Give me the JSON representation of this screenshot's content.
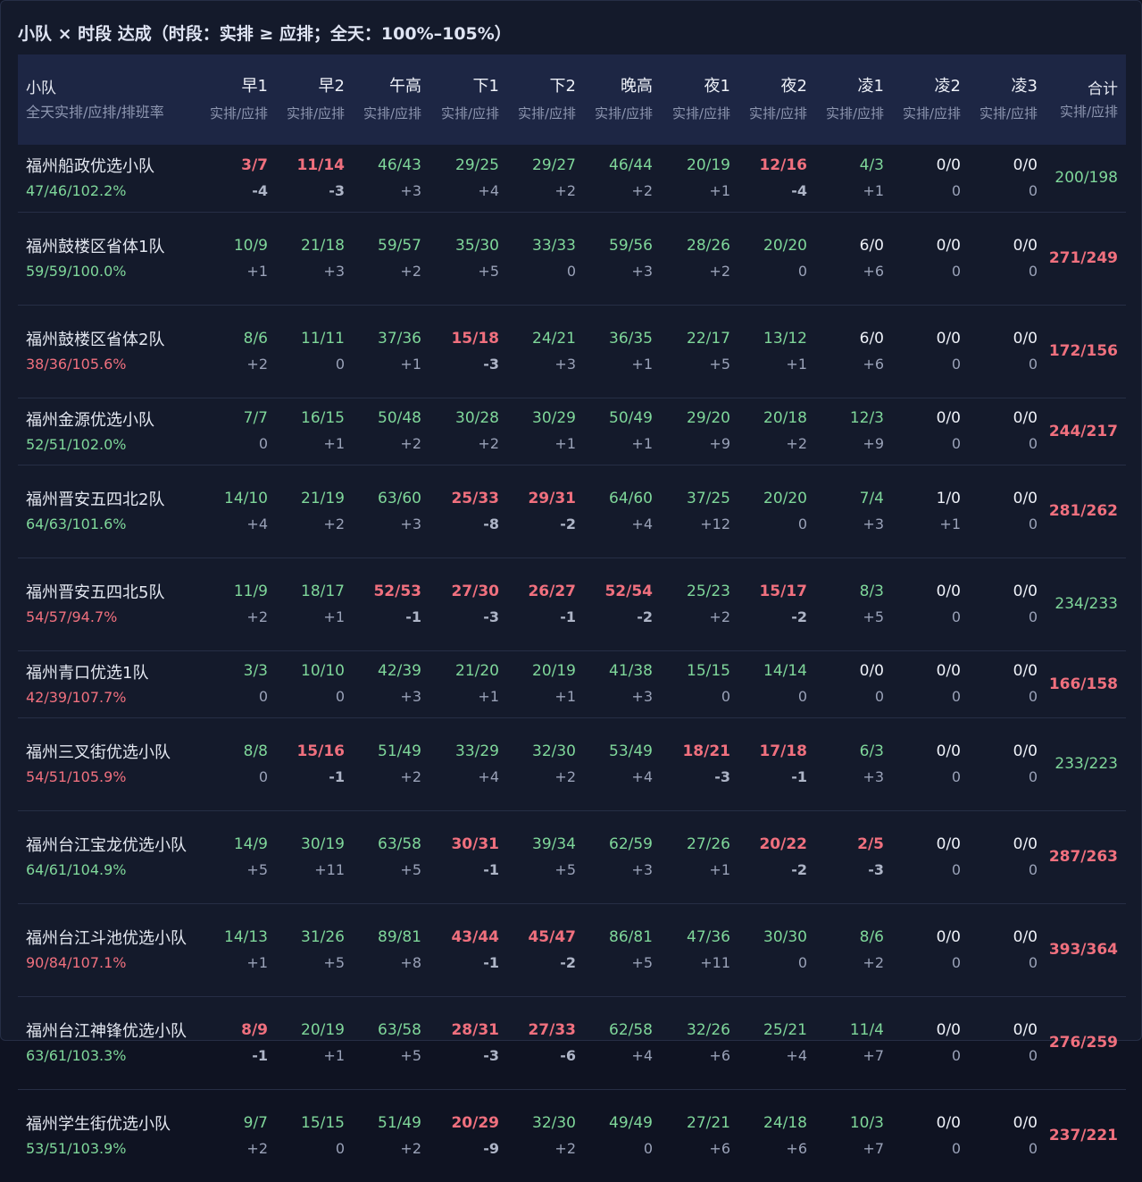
{
  "title": "小队 × 时段 达成（时段：实排 ≥ 应排；全天：100%–105%）",
  "colors": {
    "ok": "#7fd79a",
    "bad": "#f0707e",
    "neutral": "#eef1f8"
  },
  "header": {
    "team_label": "小队",
    "team_sublabel": "全天实排/应排/排班率",
    "slot_sublabel": "实排/应排",
    "total_label": "合计",
    "total_sublabel": "实排/应排",
    "slots": [
      "早1",
      "早2",
      "午高",
      "下1",
      "下2",
      "晚高",
      "夜1",
      "夜2",
      "凌1",
      "凌2",
      "凌3"
    ]
  },
  "rows": [
    {
      "name": "福州船政优选小队",
      "summary": "47/46/102.2%",
      "summary_status": "g",
      "cells": [
        {
          "v": "3/7",
          "d": "-4",
          "s": "r"
        },
        {
          "v": "11/14",
          "d": "-3",
          "s": "r"
        },
        {
          "v": "46/43",
          "d": "+3",
          "s": "g"
        },
        {
          "v": "29/25",
          "d": "+4",
          "s": "g"
        },
        {
          "v": "29/27",
          "d": "+2",
          "s": "g"
        },
        {
          "v": "46/44",
          "d": "+2",
          "s": "g"
        },
        {
          "v": "20/19",
          "d": "+1",
          "s": "g"
        },
        {
          "v": "12/16",
          "d": "-4",
          "s": "r"
        },
        {
          "v": "4/3",
          "d": "+1",
          "s": "g"
        },
        {
          "v": "0/0",
          "d": "0",
          "s": "w"
        },
        {
          "v": "0/0",
          "d": "0",
          "s": "w"
        }
      ],
      "total": "200/198",
      "total_status": "g"
    },
    {
      "name": "福州鼓楼区省体1队",
      "summary": "59/59/100.0%",
      "summary_status": "g",
      "cells": [
        {
          "v": "10/9",
          "d": "+1",
          "s": "g"
        },
        {
          "v": "21/18",
          "d": "+3",
          "s": "g"
        },
        {
          "v": "59/57",
          "d": "+2",
          "s": "g"
        },
        {
          "v": "35/30",
          "d": "+5",
          "s": "g"
        },
        {
          "v": "33/33",
          "d": "0",
          "s": "g"
        },
        {
          "v": "59/56",
          "d": "+3",
          "s": "g"
        },
        {
          "v": "28/26",
          "d": "+2",
          "s": "g"
        },
        {
          "v": "20/20",
          "d": "0",
          "s": "g"
        },
        {
          "v": "6/0",
          "d": "+6",
          "s": "w"
        },
        {
          "v": "0/0",
          "d": "0",
          "s": "w"
        },
        {
          "v": "0/0",
          "d": "0",
          "s": "w"
        }
      ],
      "total": "271/249",
      "total_status": "r"
    },
    {
      "name": "福州鼓楼区省体2队",
      "summary": "38/36/105.6%",
      "summary_status": "r",
      "cells": [
        {
          "v": "8/6",
          "d": "+2",
          "s": "g"
        },
        {
          "v": "11/11",
          "d": "0",
          "s": "g"
        },
        {
          "v": "37/36",
          "d": "+1",
          "s": "g"
        },
        {
          "v": "15/18",
          "d": "-3",
          "s": "r"
        },
        {
          "v": "24/21",
          "d": "+3",
          "s": "g"
        },
        {
          "v": "36/35",
          "d": "+1",
          "s": "g"
        },
        {
          "v": "22/17",
          "d": "+5",
          "s": "g"
        },
        {
          "v": "13/12",
          "d": "+1",
          "s": "g"
        },
        {
          "v": "6/0",
          "d": "+6",
          "s": "w"
        },
        {
          "v": "0/0",
          "d": "0",
          "s": "w"
        },
        {
          "v": "0/0",
          "d": "0",
          "s": "w"
        }
      ],
      "total": "172/156",
      "total_status": "r"
    },
    {
      "name": "福州金源优选小队",
      "summary": "52/51/102.0%",
      "summary_status": "g",
      "cells": [
        {
          "v": "7/7",
          "d": "0",
          "s": "g"
        },
        {
          "v": "16/15",
          "d": "+1",
          "s": "g"
        },
        {
          "v": "50/48",
          "d": "+2",
          "s": "g"
        },
        {
          "v": "30/28",
          "d": "+2",
          "s": "g"
        },
        {
          "v": "30/29",
          "d": "+1",
          "s": "g"
        },
        {
          "v": "50/49",
          "d": "+1",
          "s": "g"
        },
        {
          "v": "29/20",
          "d": "+9",
          "s": "g"
        },
        {
          "v": "20/18",
          "d": "+2",
          "s": "g"
        },
        {
          "v": "12/3",
          "d": "+9",
          "s": "g"
        },
        {
          "v": "0/0",
          "d": "0",
          "s": "w"
        },
        {
          "v": "0/0",
          "d": "0",
          "s": "w"
        }
      ],
      "total": "244/217",
      "total_status": "r"
    },
    {
      "name": "福州晋安五四北2队",
      "summary": "64/63/101.6%",
      "summary_status": "g",
      "cells": [
        {
          "v": "14/10",
          "d": "+4",
          "s": "g"
        },
        {
          "v": "21/19",
          "d": "+2",
          "s": "g"
        },
        {
          "v": "63/60",
          "d": "+3",
          "s": "g"
        },
        {
          "v": "25/33",
          "d": "-8",
          "s": "r"
        },
        {
          "v": "29/31",
          "d": "-2",
          "s": "r"
        },
        {
          "v": "64/60",
          "d": "+4",
          "s": "g"
        },
        {
          "v": "37/25",
          "d": "+12",
          "s": "g"
        },
        {
          "v": "20/20",
          "d": "0",
          "s": "g"
        },
        {
          "v": "7/4",
          "d": "+3",
          "s": "g"
        },
        {
          "v": "1/0",
          "d": "+1",
          "s": "w"
        },
        {
          "v": "0/0",
          "d": "0",
          "s": "w"
        }
      ],
      "total": "281/262",
      "total_status": "r"
    },
    {
      "name": "福州晋安五四北5队",
      "summary": "54/57/94.7%",
      "summary_status": "r",
      "cells": [
        {
          "v": "11/9",
          "d": "+2",
          "s": "g"
        },
        {
          "v": "18/17",
          "d": "+1",
          "s": "g"
        },
        {
          "v": "52/53",
          "d": "-1",
          "s": "r"
        },
        {
          "v": "27/30",
          "d": "-3",
          "s": "r"
        },
        {
          "v": "26/27",
          "d": "-1",
          "s": "r"
        },
        {
          "v": "52/54",
          "d": "-2",
          "s": "r"
        },
        {
          "v": "25/23",
          "d": "+2",
          "s": "g"
        },
        {
          "v": "15/17",
          "d": "-2",
          "s": "r"
        },
        {
          "v": "8/3",
          "d": "+5",
          "s": "g"
        },
        {
          "v": "0/0",
          "d": "0",
          "s": "w"
        },
        {
          "v": "0/0",
          "d": "0",
          "s": "w"
        }
      ],
      "total": "234/233",
      "total_status": "g"
    },
    {
      "name": "福州青口优选1队",
      "summary": "42/39/107.7%",
      "summary_status": "r",
      "cells": [
        {
          "v": "3/3",
          "d": "0",
          "s": "g"
        },
        {
          "v": "10/10",
          "d": "0",
          "s": "g"
        },
        {
          "v": "42/39",
          "d": "+3",
          "s": "g"
        },
        {
          "v": "21/20",
          "d": "+1",
          "s": "g"
        },
        {
          "v": "20/19",
          "d": "+1",
          "s": "g"
        },
        {
          "v": "41/38",
          "d": "+3",
          "s": "g"
        },
        {
          "v": "15/15",
          "d": "0",
          "s": "g"
        },
        {
          "v": "14/14",
          "d": "0",
          "s": "g"
        },
        {
          "v": "0/0",
          "d": "0",
          "s": "w"
        },
        {
          "v": "0/0",
          "d": "0",
          "s": "w"
        },
        {
          "v": "0/0",
          "d": "0",
          "s": "w"
        }
      ],
      "total": "166/158",
      "total_status": "r"
    },
    {
      "name": "福州三叉街优选小队",
      "summary": "54/51/105.9%",
      "summary_status": "r",
      "cells": [
        {
          "v": "8/8",
          "d": "0",
          "s": "g"
        },
        {
          "v": "15/16",
          "d": "-1",
          "s": "r"
        },
        {
          "v": "51/49",
          "d": "+2",
          "s": "g"
        },
        {
          "v": "33/29",
          "d": "+4",
          "s": "g"
        },
        {
          "v": "32/30",
          "d": "+2",
          "s": "g"
        },
        {
          "v": "53/49",
          "d": "+4",
          "s": "g"
        },
        {
          "v": "18/21",
          "d": "-3",
          "s": "r"
        },
        {
          "v": "17/18",
          "d": "-1",
          "s": "r"
        },
        {
          "v": "6/3",
          "d": "+3",
          "s": "g"
        },
        {
          "v": "0/0",
          "d": "0",
          "s": "w"
        },
        {
          "v": "0/0",
          "d": "0",
          "s": "w"
        }
      ],
      "total": "233/223",
      "total_status": "g"
    },
    {
      "name": "福州台江宝龙优选小队",
      "summary": "64/61/104.9%",
      "summary_status": "g",
      "cells": [
        {
          "v": "14/9",
          "d": "+5",
          "s": "g"
        },
        {
          "v": "30/19",
          "d": "+11",
          "s": "g"
        },
        {
          "v": "63/58",
          "d": "+5",
          "s": "g"
        },
        {
          "v": "30/31",
          "d": "-1",
          "s": "r"
        },
        {
          "v": "39/34",
          "d": "+5",
          "s": "g"
        },
        {
          "v": "62/59",
          "d": "+3",
          "s": "g"
        },
        {
          "v": "27/26",
          "d": "+1",
          "s": "g"
        },
        {
          "v": "20/22",
          "d": "-2",
          "s": "r"
        },
        {
          "v": "2/5",
          "d": "-3",
          "s": "r"
        },
        {
          "v": "0/0",
          "d": "0",
          "s": "w"
        },
        {
          "v": "0/0",
          "d": "0",
          "s": "w"
        }
      ],
      "total": "287/263",
      "total_status": "r"
    },
    {
      "name": "福州台江斗池优选小队",
      "summary": "90/84/107.1%",
      "summary_status": "r",
      "cells": [
        {
          "v": "14/13",
          "d": "+1",
          "s": "g"
        },
        {
          "v": "31/26",
          "d": "+5",
          "s": "g"
        },
        {
          "v": "89/81",
          "d": "+8",
          "s": "g"
        },
        {
          "v": "43/44",
          "d": "-1",
          "s": "r"
        },
        {
          "v": "45/47",
          "d": "-2",
          "s": "r"
        },
        {
          "v": "86/81",
          "d": "+5",
          "s": "g"
        },
        {
          "v": "47/36",
          "d": "+11",
          "s": "g"
        },
        {
          "v": "30/30",
          "d": "0",
          "s": "g"
        },
        {
          "v": "8/6",
          "d": "+2",
          "s": "g"
        },
        {
          "v": "0/0",
          "d": "0",
          "s": "w"
        },
        {
          "v": "0/0",
          "d": "0",
          "s": "w"
        }
      ],
      "total": "393/364",
      "total_status": "r"
    },
    {
      "name": "福州台江神锋优选小队",
      "summary": "63/61/103.3%",
      "summary_status": "g",
      "cells": [
        {
          "v": "8/9",
          "d": "-1",
          "s": "r"
        },
        {
          "v": "20/19",
          "d": "+1",
          "s": "g"
        },
        {
          "v": "63/58",
          "d": "+5",
          "s": "g"
        },
        {
          "v": "28/31",
          "d": "-3",
          "s": "r"
        },
        {
          "v": "27/33",
          "d": "-6",
          "s": "r"
        },
        {
          "v": "62/58",
          "d": "+4",
          "s": "g"
        },
        {
          "v": "32/26",
          "d": "+6",
          "s": "g"
        },
        {
          "v": "25/21",
          "d": "+4",
          "s": "g"
        },
        {
          "v": "11/4",
          "d": "+7",
          "s": "g"
        },
        {
          "v": "0/0",
          "d": "0",
          "s": "w"
        },
        {
          "v": "0/0",
          "d": "0",
          "s": "w"
        }
      ],
      "total": "276/259",
      "total_status": "r"
    },
    {
      "name": "福州学生街优选小队",
      "summary": "53/51/103.9%",
      "summary_status": "g",
      "cells": [
        {
          "v": "9/7",
          "d": "+2",
          "s": "g"
        },
        {
          "v": "15/15",
          "d": "0",
          "s": "g"
        },
        {
          "v": "51/49",
          "d": "+2",
          "s": "g"
        },
        {
          "v": "20/29",
          "d": "-9",
          "s": "r"
        },
        {
          "v": "32/30",
          "d": "+2",
          "s": "g"
        },
        {
          "v": "49/49",
          "d": "0",
          "s": "g"
        },
        {
          "v": "27/21",
          "d": "+6",
          "s": "g"
        },
        {
          "v": "24/18",
          "d": "+6",
          "s": "g"
        },
        {
          "v": "10/3",
          "d": "+7",
          "s": "g"
        },
        {
          "v": "0/0",
          "d": "0",
          "s": "w"
        },
        {
          "v": "0/0",
          "d": "0",
          "s": "w"
        }
      ],
      "total": "237/221",
      "total_status": "r"
    }
  ]
}
